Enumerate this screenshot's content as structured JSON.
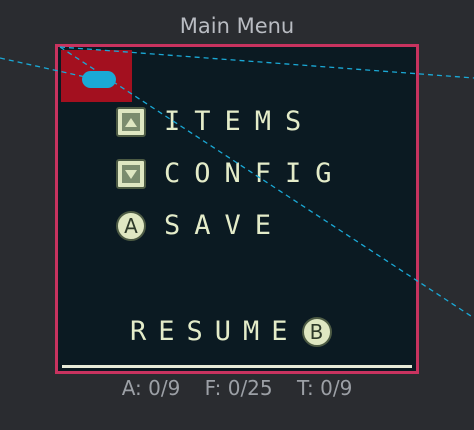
{
  "window": {
    "title": "Main Menu"
  },
  "menu": {
    "items": [
      {
        "label": "ITEMS",
        "button": "up-arrow"
      },
      {
        "label": "CONFIG",
        "button": "down-arrow"
      },
      {
        "label": "SAVE",
        "button": "A"
      }
    ],
    "resume": {
      "label": "RESUME",
      "button": "B"
    }
  },
  "status": {
    "a": "A: 0/9",
    "f": "F: 0/25",
    "t": "T: 0/9"
  },
  "colors": {
    "frame_border": "#c8335f",
    "screen_bg": "#0b1a22",
    "cursor_box": "#a3101f",
    "cursor_pill": "#1aa9d6",
    "menu_text": "#e4ecc9",
    "guide_line": "#1aa9d6"
  }
}
